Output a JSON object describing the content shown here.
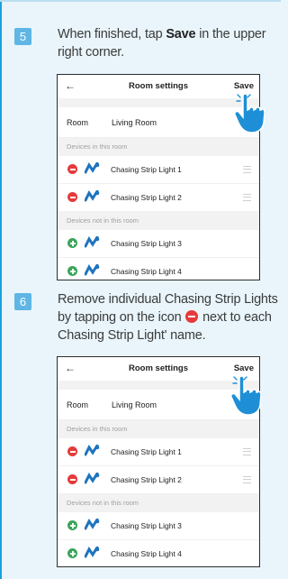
{
  "steps": [
    {
      "number": "5",
      "text_before": "When finished, tap ",
      "text_bold": "Save",
      "text_after": " in the upper right corner."
    },
    {
      "number": "6",
      "text_before": "Remove individual Chasing Strip Lights by tapping on the icon ",
      "text_after": " next to each Chasing Strip Light' name."
    }
  ],
  "screen1": {
    "back_icon": "back-arrow-icon",
    "title": "Room settings",
    "save_label": "Save",
    "room_key": "Room",
    "room_value": "Living Room",
    "section_in": "Devices in this room",
    "section_out": "Devices not in this room",
    "devices_in": [
      {
        "name": "Chasing Strip Light 1"
      },
      {
        "name": "Chasing Strip Light 2"
      }
    ],
    "devices_out": [
      {
        "name": "Chasing Strip Light 3"
      },
      {
        "name": "Chasing Strip Light 4"
      }
    ]
  },
  "screen2": {
    "back_icon": "back-arrow-icon",
    "title": "Room settings",
    "save_label": "Save",
    "room_key": "Room",
    "room_value": "Living Room",
    "section_in": "Devices in this room",
    "section_out": "Devices not in this room",
    "devices_in": [
      {
        "name": "Chasing Strip Light 1"
      },
      {
        "name": "Chasing Strip Light 2"
      }
    ],
    "devices_out": [
      {
        "name": "Chasing Strip Light 3"
      },
      {
        "name": "Chasing Strip Light 4"
      }
    ]
  },
  "colors": {
    "background": "#e9f5fb",
    "step_badge": "#5fb6e5",
    "remove": "#e63a3a",
    "add": "#3aa55a",
    "device_icon": "#1e73be",
    "hand": "#1e8fd6"
  }
}
